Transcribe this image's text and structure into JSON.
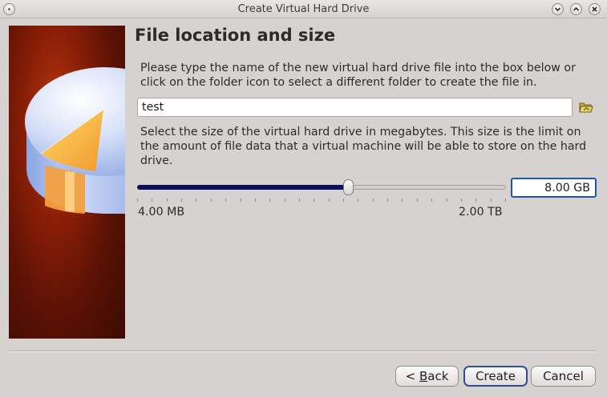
{
  "window": {
    "title": "Create Virtual Hard Drive"
  },
  "page": {
    "title": "File location and size",
    "location_description": "Please type the name of the new virtual hard drive file into the box below or click on the folder icon to select a different folder to create the file in.",
    "file_name": "test",
    "size_description": "Select the size of the virtual hard drive in megabytes. This size is the limit on the amount of file data that a virtual machine will be able to store on the hard drive.",
    "size_value": "8.00 GB",
    "size_slider_fraction": 0.574,
    "range_min": "4.00 MB",
    "range_max": "2.00 TB"
  },
  "buttons": {
    "back_prefix": "< ",
    "back_mnemonic": "B",
    "back_rest": "ack",
    "create": "Create",
    "cancel": "Cancel"
  },
  "colors": {
    "accent": "#1f57a8",
    "slider_fill": "#0e0f5c",
    "banner": "#8a1e06"
  },
  "icons": {
    "folder": "folder-open-icon",
    "window_menu": "window-menu-icon",
    "minimize": "minimize-icon",
    "maximize": "maximize-icon",
    "close": "close-icon"
  }
}
